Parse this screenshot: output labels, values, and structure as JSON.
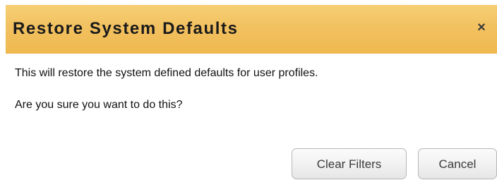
{
  "dialog": {
    "title": "Restore System Defaults",
    "close_label": "×",
    "message_line1": "This will restore the system defined defaults for user profiles.",
    "message_line2": "Are you sure you want to do this?",
    "buttons": {
      "clear_filters": "Clear Filters",
      "cancel": "Cancel"
    }
  },
  "colors": {
    "titlebar_top": "#f6cf74",
    "titlebar_bottom": "#efb84f",
    "button_border": "#b7b7b7",
    "text": "#111111"
  }
}
